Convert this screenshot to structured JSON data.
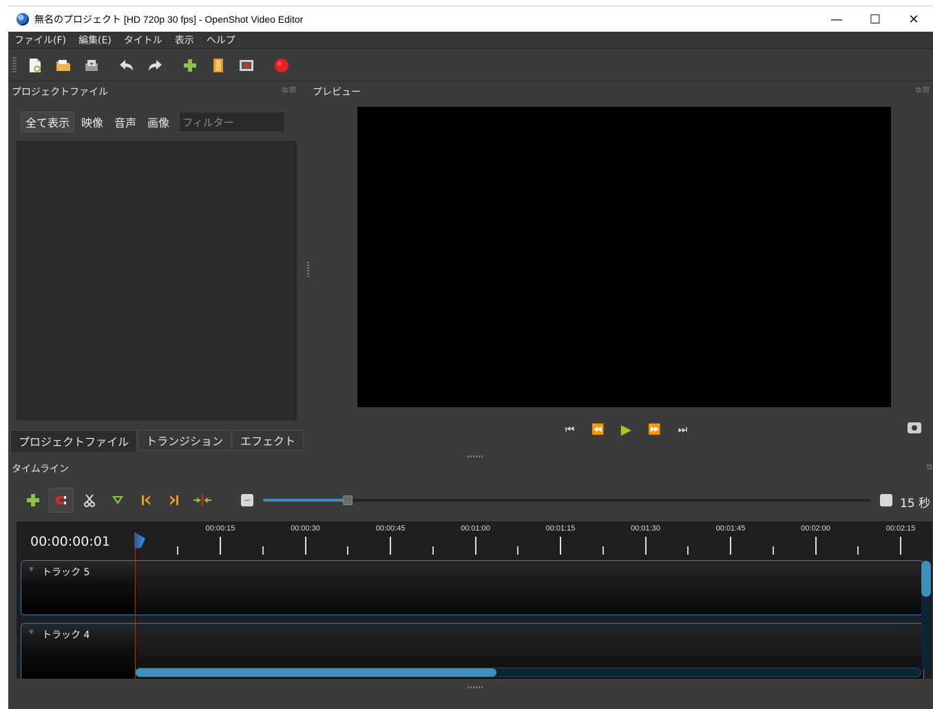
{
  "window": {
    "title": "無名のプロジェクト [HD 720p 30 fps] - OpenShot Video Editor",
    "minimize": "—",
    "maximize": "☐",
    "close": "✕"
  },
  "menu": [
    "ファイル(F)",
    "編集(E)",
    "タイトル",
    "表示",
    "ヘルプ"
  ],
  "toolbar": {
    "icons": [
      "new-project-icon",
      "open-project-icon",
      "save-project-icon",
      "undo-icon",
      "redo-icon",
      "import-files-icon",
      "profile-icon",
      "fullscreen-icon",
      "export-video-icon"
    ]
  },
  "project_files": {
    "title": "プロジェクトファイル",
    "filters": [
      "全て表示",
      "映像",
      "音声",
      "画像"
    ],
    "filter_placeholder": "フィルター"
  },
  "bottom_tabs": [
    "プロジェクトファイル",
    "トランジション",
    "エフェクト"
  ],
  "preview": {
    "title": "プレビュー"
  },
  "timeline": {
    "title": "タイムライン",
    "current_time": "00:00:00:01",
    "zoom_label": "15 秒",
    "zoom_fraction": 0.14,
    "ruler_labels": [
      "00:00:15",
      "00:00:30",
      "00:00:45",
      "00:01:00",
      "00:01:15",
      "00:01:30",
      "00:01:45",
      "00:02:00",
      "00:02:15"
    ],
    "tracks": [
      {
        "label": "トラック 5"
      },
      {
        "label": "トラック 4"
      }
    ],
    "h_scroll_fraction": 0.46
  },
  "colors": {
    "background": "#3b3b3b",
    "accent_green": "#9ad121",
    "accent_blue": "#3f8fb8",
    "playhead_red": "#d21b1b",
    "record_red": "#e02424"
  }
}
